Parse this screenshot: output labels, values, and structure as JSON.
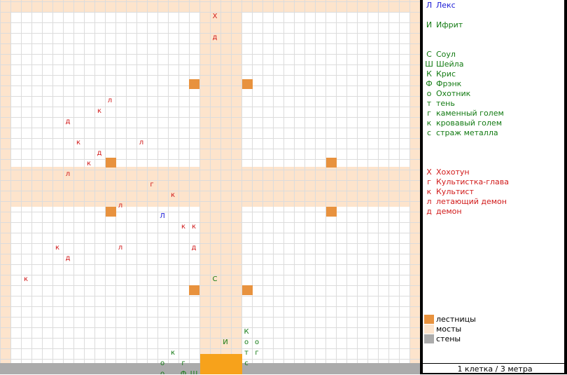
{
  "colors": {
    "bridge": "#fde4cc",
    "stairs": "#e8923e",
    "wall": "#ababab",
    "grid_line": "#dcdcdc",
    "player": "#1a1ad6",
    "ally": "#127a12",
    "enemy": "#d11a1a"
  },
  "tokens": [
    {
      "ch": "Х",
      "col": 20,
      "row": 1,
      "side": "enemy"
    },
    {
      "ch": "д",
      "col": 20,
      "row": 3,
      "side": "enemy"
    },
    {
      "ch": "л",
      "col": 10,
      "row": 9,
      "side": "enemy"
    },
    {
      "ch": "к",
      "col": 9,
      "row": 10,
      "side": "enemy"
    },
    {
      "ch": "д",
      "col": 6,
      "row": 11,
      "side": "enemy"
    },
    {
      "ch": "к",
      "col": 7,
      "row": 13,
      "side": "enemy"
    },
    {
      "ch": "л",
      "col": 13,
      "row": 13,
      "side": "enemy"
    },
    {
      "ch": "д",
      "col": 9,
      "row": 14,
      "side": "enemy"
    },
    {
      "ch": "к",
      "col": 8,
      "row": 15,
      "side": "enemy"
    },
    {
      "ch": "л",
      "col": 6,
      "row": 16,
      "side": "enemy"
    },
    {
      "ch": "г",
      "col": 14,
      "row": 17,
      "side": "enemy"
    },
    {
      "ch": "к",
      "col": 16,
      "row": 18,
      "side": "enemy"
    },
    {
      "ch": "л",
      "col": 11,
      "row": 19,
      "side": "enemy"
    },
    {
      "ch": "Л",
      "col": 15,
      "row": 20,
      "side": "player"
    },
    {
      "ch": "к",
      "col": 17,
      "row": 21,
      "side": "enemy"
    },
    {
      "ch": "к",
      "col": 18,
      "row": 21,
      "side": "enemy"
    },
    {
      "ch": "к",
      "col": 5,
      "row": 23,
      "side": "enemy"
    },
    {
      "ch": "л",
      "col": 11,
      "row": 23,
      "side": "enemy"
    },
    {
      "ch": "д",
      "col": 18,
      "row": 23,
      "side": "enemy"
    },
    {
      "ch": "д",
      "col": 6,
      "row": 24,
      "side": "enemy"
    },
    {
      "ch": "к",
      "col": 2,
      "row": 26,
      "side": "enemy"
    },
    {
      "ch": "С",
      "col": 20,
      "row": 26,
      "side": "ally"
    },
    {
      "ch": "К",
      "col": 23,
      "row": 31,
      "side": "ally"
    },
    {
      "ch": "И",
      "col": 21,
      "row": 32,
      "side": "ally"
    },
    {
      "ch": "о",
      "col": 23,
      "row": 32,
      "side": "ally"
    },
    {
      "ch": "о",
      "col": 24,
      "row": 32,
      "side": "ally"
    },
    {
      "ch": "к",
      "col": 16,
      "row": 33,
      "side": "ally"
    },
    {
      "ch": "т",
      "col": 23,
      "row": 33,
      "side": "ally"
    },
    {
      "ch": "г",
      "col": 24,
      "row": 33,
      "side": "ally"
    },
    {
      "ch": "о",
      "col": 15,
      "row": 34,
      "side": "ally"
    },
    {
      "ch": "г",
      "col": 17,
      "row": 34,
      "side": "ally"
    },
    {
      "ch": "с",
      "col": 23,
      "row": 34,
      "side": "ally"
    },
    {
      "ch": "о",
      "col": 15,
      "row": 35,
      "side": "ally"
    },
    {
      "ch": "Ф",
      "col": 17,
      "row": 35,
      "side": "ally"
    },
    {
      "ch": "Ш",
      "col": 18,
      "row": 35,
      "side": "ally"
    }
  ],
  "legend": {
    "entries": [
      {
        "sym": "Л",
        "name": "Лекс",
        "side": "player",
        "line": 0
      },
      {
        "sym": "И",
        "name": "Ифрит",
        "side": "ally",
        "line": 2
      },
      {
        "sym": "С",
        "name": "Соул",
        "side": "ally",
        "line": 5
      },
      {
        "sym": "Ш",
        "name": "Шейла",
        "side": "ally",
        "line": 6
      },
      {
        "sym": "К",
        "name": "Крис",
        "side": "ally",
        "line": 7
      },
      {
        "sym": "Ф",
        "name": "Фрэнк",
        "side": "ally",
        "line": 8
      },
      {
        "sym": "о",
        "name": "Охотник",
        "side": "ally",
        "line": 9
      },
      {
        "sym": "т",
        "name": "тень",
        "side": "ally",
        "line": 10
      },
      {
        "sym": "г",
        "name": "каменный голем",
        "side": "ally",
        "line": 11
      },
      {
        "sym": "к",
        "name": "кровавый голем",
        "side": "ally",
        "line": 12
      },
      {
        "sym": "с",
        "name": "страж металла",
        "side": "ally",
        "line": 13
      },
      {
        "sym": "Х",
        "name": "Хохотун",
        "side": "enemy",
        "line": 17
      },
      {
        "sym": "г",
        "name": "Культистка-глава",
        "side": "enemy",
        "line": 18
      },
      {
        "sym": "к",
        "name": "Культист",
        "side": "enemy",
        "line": 19
      },
      {
        "sym": "л",
        "name": "летающий демон",
        "side": "enemy",
        "line": 20
      },
      {
        "sym": "д",
        "name": "демон",
        "side": "enemy",
        "line": 21
      }
    ],
    "terrain": [
      {
        "name": "лестницы",
        "color": "stairs",
        "line": 32
      },
      {
        "name": "мосты",
        "color": "bridge",
        "line": 33
      },
      {
        "name": "стены",
        "color": "wall",
        "line": 34
      }
    ]
  },
  "scale_label": "1 клетка / 3 метра"
}
